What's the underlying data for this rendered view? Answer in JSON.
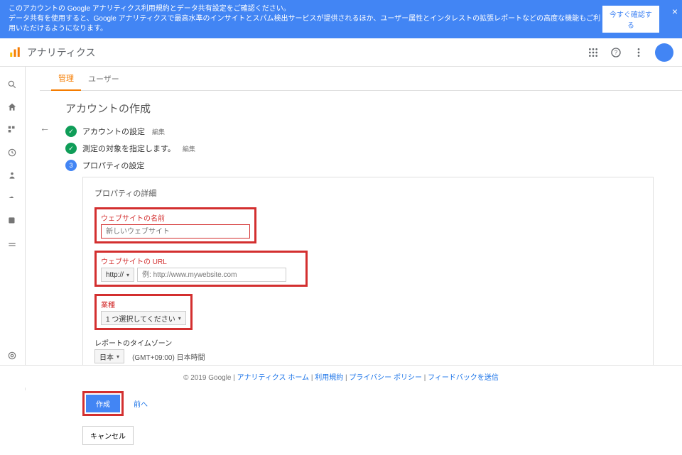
{
  "banner": {
    "line1": "このアカウントの Google アナリティクス利用規約とデータ共有設定をご確認ください。",
    "line2": "データ共有を使用すると、Google アナリティクスで最高水準のインサイトとスパム検出サービスが提供されるほか、ユーザー属性とインタレストの拡張レポートなどの高度な機能もご利用いただけるようになります。",
    "confirm_btn": "今すぐ確認する"
  },
  "topbar": {
    "app_name": "アナリティクス"
  },
  "tabs": {
    "admin": "管理",
    "user": "ユーザー"
  },
  "page": {
    "title": "アカウントの作成",
    "step1": "アカウントの設定",
    "step2": "測定の対象を指定します。",
    "step3": "プロパティの設定",
    "edit": "編集"
  },
  "panel": {
    "title": "プロパティの詳細",
    "website_name_label": "ウェブサイトの名前",
    "website_name_placeholder": "新しいウェブサイト",
    "website_url_label": "ウェブサイトの URL",
    "protocol": "http://",
    "url_placeholder": "例: http://www.mywebsite.com",
    "industry_label": "業種",
    "industry_select": "1 つ選択してください",
    "timezone_label": "レポートのタイムゾーン",
    "country": "日本",
    "timezone_text": "(GMT+09:00) 日本時間"
  },
  "buttons": {
    "create": "作成",
    "prev": "前へ",
    "cancel": "キャンセル"
  },
  "footer": {
    "copyright": "© 2019 Google",
    "home": "アナリティクス ホーム",
    "terms": "利用規約",
    "privacy": "プライバシー ポリシー",
    "feedback": "フィードバックを送信"
  }
}
